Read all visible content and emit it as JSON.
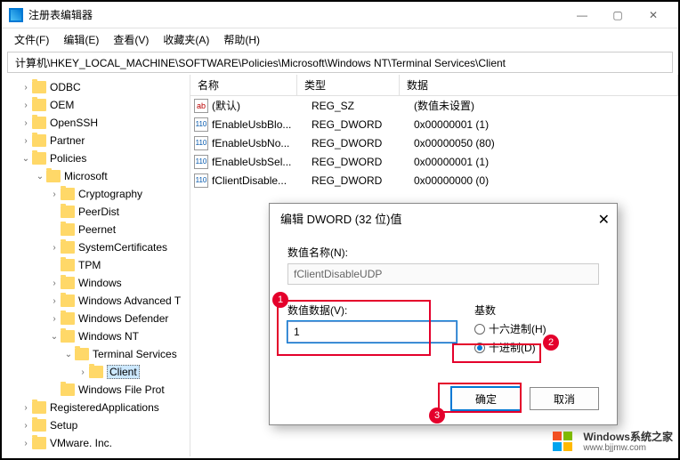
{
  "window": {
    "title": "注册表编辑器",
    "menu": [
      "文件(F)",
      "编辑(E)",
      "查看(V)",
      "收藏夹(A)",
      "帮助(H)"
    ],
    "path": "计算机\\HKEY_LOCAL_MACHINE\\SOFTWARE\\Policies\\Microsoft\\Windows NT\\Terminal Services\\Client"
  },
  "tree": [
    {
      "indent": 1,
      "chev": "›",
      "label": "ODBC"
    },
    {
      "indent": 1,
      "chev": "›",
      "label": "OEM"
    },
    {
      "indent": 1,
      "chev": "›",
      "label": "OpenSSH"
    },
    {
      "indent": 1,
      "chev": "›",
      "label": "Partner"
    },
    {
      "indent": 1,
      "chev": "⌄",
      "label": "Policies"
    },
    {
      "indent": 2,
      "chev": "⌄",
      "label": "Microsoft"
    },
    {
      "indent": 3,
      "chev": "›",
      "label": "Cryptography"
    },
    {
      "indent": 3,
      "chev": "",
      "label": "PeerDist"
    },
    {
      "indent": 3,
      "chev": "",
      "label": "Peernet"
    },
    {
      "indent": 3,
      "chev": "›",
      "label": "SystemCertificates"
    },
    {
      "indent": 3,
      "chev": "",
      "label": "TPM"
    },
    {
      "indent": 3,
      "chev": "›",
      "label": "Windows"
    },
    {
      "indent": 3,
      "chev": "›",
      "label": "Windows Advanced T"
    },
    {
      "indent": 3,
      "chev": "›",
      "label": "Windows Defender"
    },
    {
      "indent": 3,
      "chev": "⌄",
      "label": "Windows NT"
    },
    {
      "indent": 4,
      "chev": "⌄",
      "label": "Terminal Services"
    },
    {
      "indent": 5,
      "chev": "›",
      "label": "Client",
      "sel": true
    },
    {
      "indent": 3,
      "chev": "",
      "label": "Windows File Prot"
    },
    {
      "indent": 1,
      "chev": "›",
      "label": "RegisteredApplications"
    },
    {
      "indent": 1,
      "chev": "›",
      "label": "Setup"
    },
    {
      "indent": 1,
      "chev": "›",
      "label": "VMware. Inc."
    }
  ],
  "list": {
    "headers": {
      "name": "名称",
      "type": "类型",
      "data": "数据"
    },
    "rows": [
      {
        "icon": "ab",
        "name": "(默认)",
        "type": "REG_SZ",
        "data": "(数值未设置)"
      },
      {
        "icon": "bin",
        "name": "fEnableUsbBlo...",
        "type": "REG_DWORD",
        "data": "0x00000001 (1)"
      },
      {
        "icon": "bin",
        "name": "fEnableUsbNo...",
        "type": "REG_DWORD",
        "data": "0x00000050 (80)"
      },
      {
        "icon": "bin",
        "name": "fEnableUsbSel...",
        "type": "REG_DWORD",
        "data": "0x00000001 (1)"
      },
      {
        "icon": "bin",
        "name": "fClientDisable...",
        "type": "REG_DWORD",
        "data": "0x00000000 (0)"
      }
    ]
  },
  "dialog": {
    "title": "编辑 DWORD (32 位)值",
    "name_label": "数值名称(N):",
    "name_value": "fClientDisableUDP",
    "data_label": "数值数据(V):",
    "data_value": "1",
    "base_label": "基数",
    "radio_hex": "十六进制(H)",
    "radio_dec": "十进制(D)",
    "ok": "确定",
    "cancel": "取消"
  },
  "annotations": {
    "n1": "1",
    "n2": "2",
    "n3": "3"
  },
  "watermark": {
    "brand": "Windows",
    "cn": "系统之家",
    "url": "www.bjjmw.com"
  }
}
